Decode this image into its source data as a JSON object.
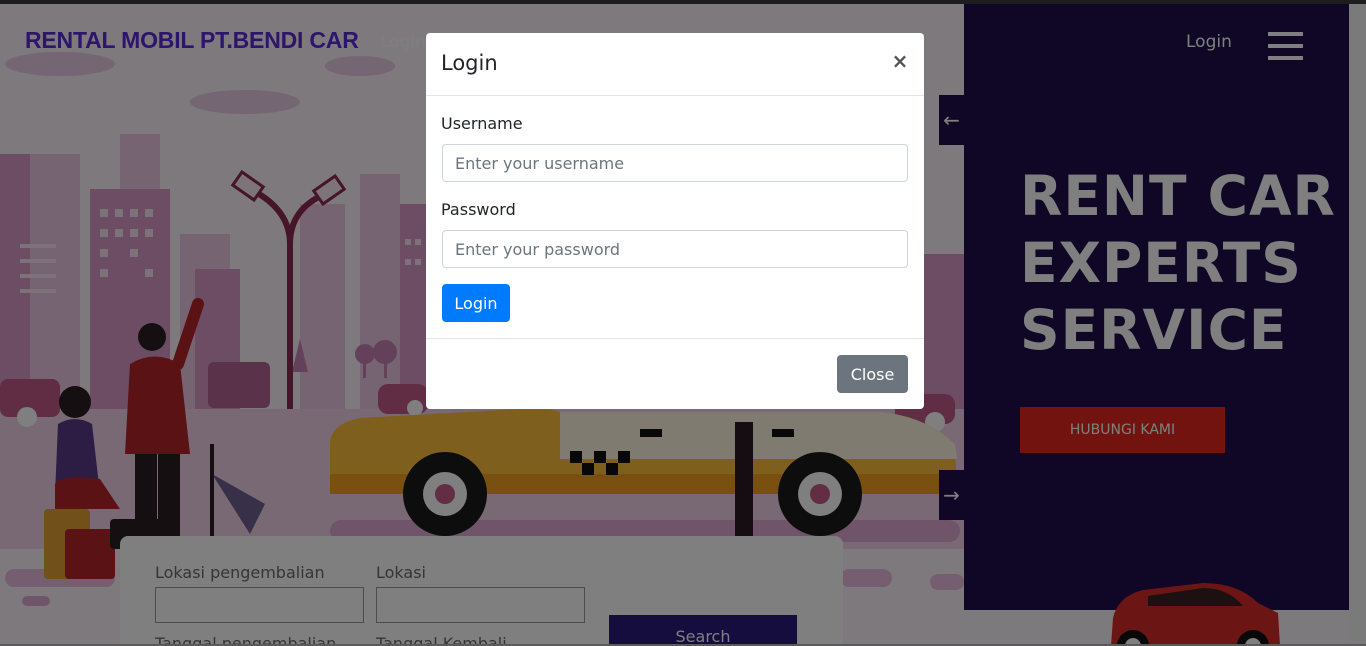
{
  "navbar": {
    "brand": "RENTAL MOBIL PT.BENDI CAR",
    "login_link": "Login",
    "right_login_link": "Login"
  },
  "hero": {
    "title_lines": [
      "RENT CAR",
      "EXPERTS",
      "SERVICE"
    ],
    "cta_label": "HUBUNGI KAMI",
    "prev_arrow": "←",
    "next_arrow": "→"
  },
  "search_form": {
    "return_location_label": "Lokasi pengembalian",
    "location_label": "Lokasi",
    "return_date_label": "Tanggal pengembalian",
    "back_date_label": "Tanggal Kembali",
    "search_label": "Search"
  },
  "modal": {
    "title": "Login",
    "close_icon": "×",
    "username_label": "Username",
    "username_placeholder": "Enter your username",
    "password_label": "Password",
    "password_placeholder": "Enter your password",
    "submit_label": "Login",
    "close_label": "Close"
  },
  "colors": {
    "brand": "#5a2bd6",
    "panel": "#1e0f4a",
    "cta": "#e4261f",
    "primary_button": "#007bff",
    "secondary_button": "#6c757d"
  }
}
